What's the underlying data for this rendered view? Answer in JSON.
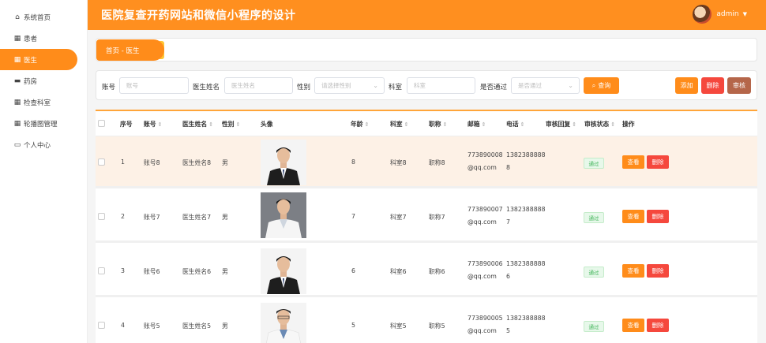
{
  "sidebar": {
    "items": [
      {
        "label": "系统首页",
        "icon": "home-icon",
        "glyph": "⌂"
      },
      {
        "label": "患者",
        "icon": "grid-icon",
        "glyph": "▦"
      },
      {
        "label": "医生",
        "icon": "grid-icon",
        "glyph": "▦"
      },
      {
        "label": "药房",
        "icon": "briefcase-icon",
        "glyph": "▬"
      },
      {
        "label": "检查科室",
        "icon": "apps-icon",
        "glyph": "▦"
      },
      {
        "label": "轮播图管理",
        "icon": "apps-icon",
        "glyph": "▦"
      },
      {
        "label": "个人中心",
        "icon": "card-icon",
        "glyph": "▭"
      }
    ],
    "active_index": 2
  },
  "header": {
    "title": "医院复查开药网站和微信小程序的设计",
    "user": "admin",
    "caret": "▼",
    "accent": "#ff8f1f"
  },
  "breadcrumb": {
    "text": "首页 - 医生"
  },
  "search": {
    "account_label": "账号",
    "account_placeholder": "账号",
    "name_label": "医生姓名",
    "name_placeholder": "医生姓名",
    "gender_label": "性别",
    "gender_placeholder": "请选择性别",
    "dept_label": "科室",
    "dept_placeholder": "科室",
    "approved_label": "是否通过",
    "approved_placeholder": "是否通过",
    "search_button": "查询",
    "add_button": "添加",
    "delete_button": "删除",
    "review_button": "审核"
  },
  "table": {
    "columns": [
      "序号",
      "账号",
      "医生姓名",
      "性别",
      "头像",
      "年龄",
      "科室",
      "职称",
      "邮箱",
      "电话",
      "审核回复",
      "审核状态",
      "操作"
    ],
    "sort_glyph": "⇕",
    "view_label": "查看",
    "delete_label": "删除",
    "rows": [
      {
        "idx": "1",
        "account": "账号8",
        "name": "医生姓名8",
        "gender": "男",
        "age": "8",
        "dept": "科室8",
        "title": "职称8",
        "email1": "773890008",
        "email2": "@qq.com",
        "phone1": "1382388888",
        "phone2": "8",
        "status": "通过"
      },
      {
        "idx": "2",
        "account": "账号7",
        "name": "医生姓名7",
        "gender": "男",
        "age": "7",
        "dept": "科室7",
        "title": "职称7",
        "email1": "773890007",
        "email2": "@qq.com",
        "phone1": "1382388888",
        "phone2": "7",
        "status": "通过"
      },
      {
        "idx": "3",
        "account": "账号6",
        "name": "医生姓名6",
        "gender": "男",
        "age": "6",
        "dept": "科室6",
        "title": "职称6",
        "email1": "773890006",
        "email2": "@qq.com",
        "phone1": "1382388888",
        "phone2": "6",
        "status": "通过"
      },
      {
        "idx": "4",
        "account": "账号5",
        "name": "医生姓名5",
        "gender": "男",
        "age": "5",
        "dept": "科室5",
        "title": "职称5",
        "email1": "773890005",
        "email2": "@qq.com",
        "phone1": "1382388888",
        "phone2": "5",
        "status": "通过"
      }
    ]
  }
}
